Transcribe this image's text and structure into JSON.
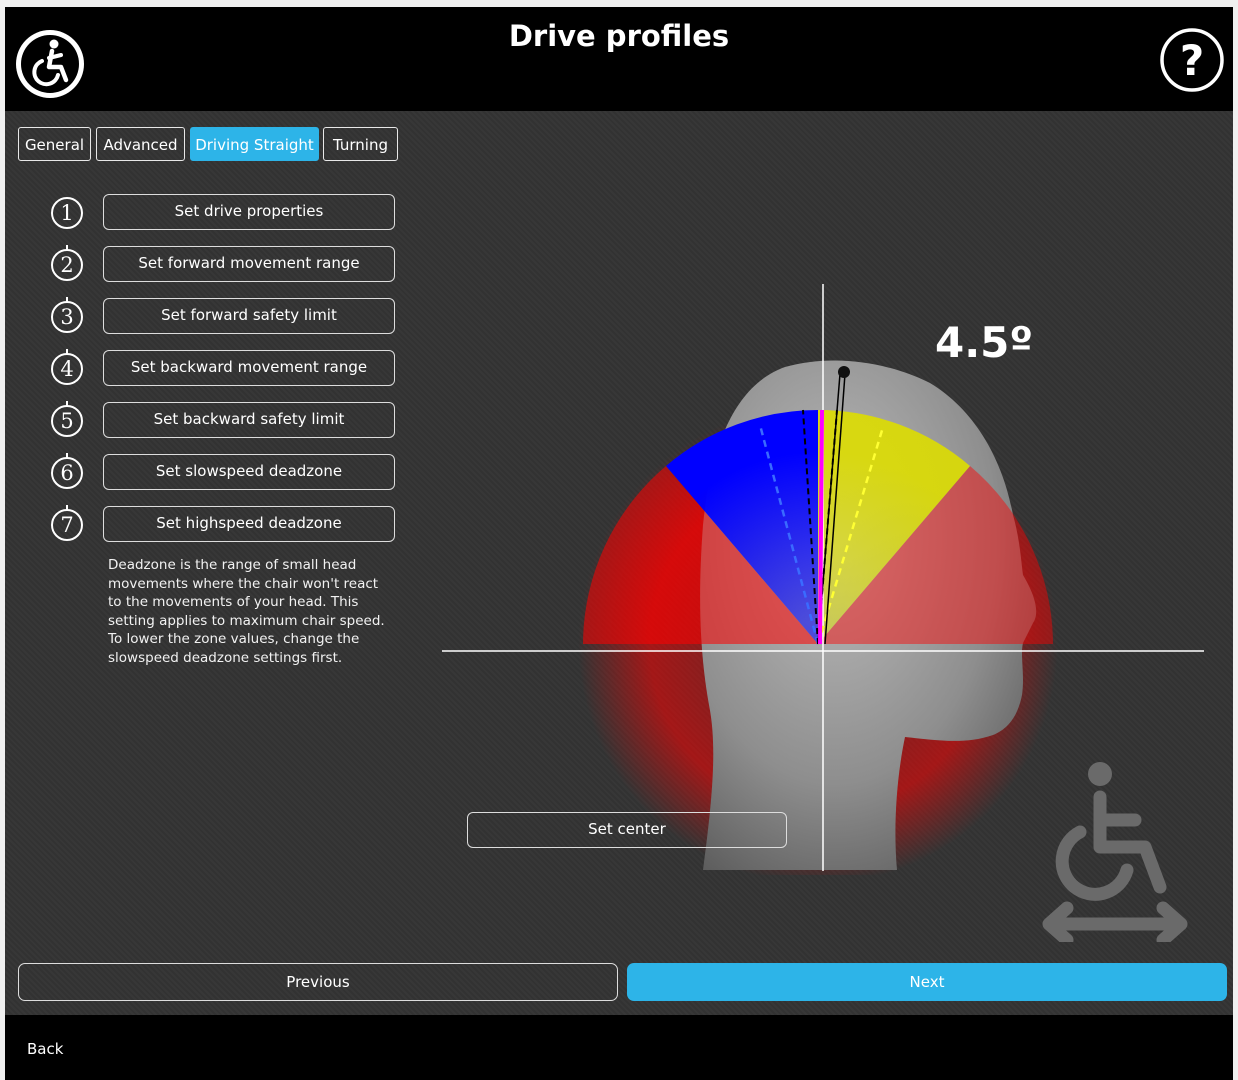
{
  "header": {
    "title": "Drive profiles"
  },
  "tabs": [
    {
      "label": "General",
      "active": false
    },
    {
      "label": "Advanced",
      "active": false
    },
    {
      "label": "Driving Straight",
      "active": true
    },
    {
      "label": "Turning",
      "active": false
    }
  ],
  "steps": [
    {
      "number": "1",
      "label": "Set drive properties"
    },
    {
      "number": "2",
      "label": "Set forward movement range"
    },
    {
      "number": "3",
      "label": "Set forward safety limit"
    },
    {
      "number": "4",
      "label": "Set backward movement range"
    },
    {
      "number": "5",
      "label": "Set backward safety limit"
    },
    {
      "number": "6",
      "label": "Set slowspeed deadzone"
    },
    {
      "number": "7",
      "label": "Set highspeed deadzone"
    }
  ],
  "description": "Deadzone is the range of small head movements where the chair won't react to the movements of your head. This setting applies to maximum chair speed. To lower the zone values, change the slowspeed deadzone settings first.",
  "head_tilt_angle": "4.5º",
  "set_center_label": "Set center",
  "nav": {
    "previous_label": "Previous",
    "next_label": "Next"
  },
  "footer": {
    "back_label": "Back"
  },
  "colors": {
    "accent": "#2db4e8",
    "safety_limit": "#ff0000",
    "backward_range": "#0000ff",
    "forward_range": "#e6e600",
    "current_position": "#ff00ff"
  },
  "icons": [
    "accessibility-icon",
    "help-icon",
    "wheelchair-move-icon"
  ]
}
